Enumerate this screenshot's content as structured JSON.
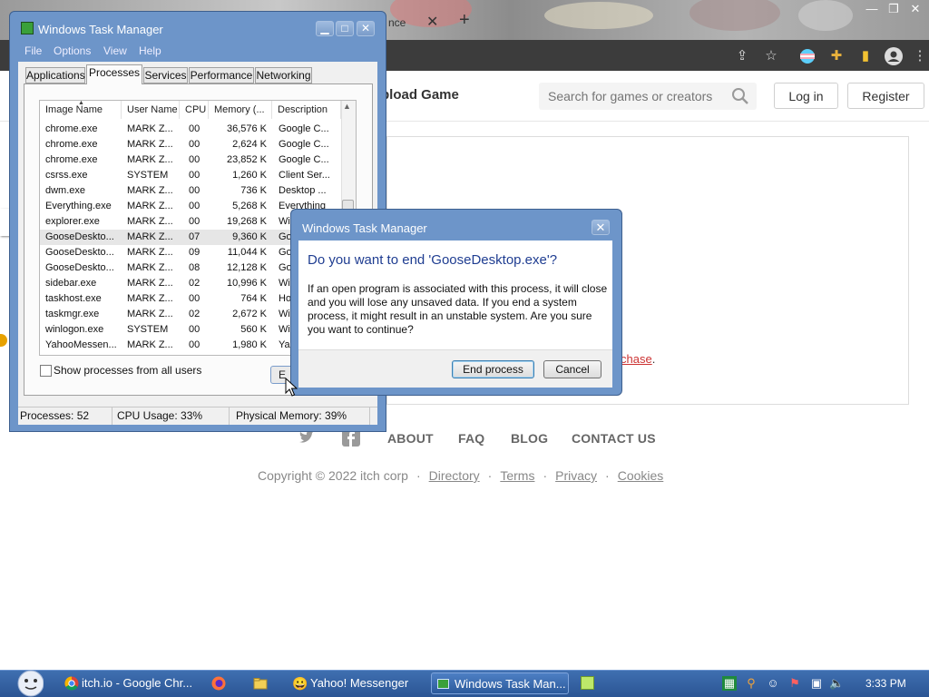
{
  "browser": {
    "tab_fragment": "nce",
    "new_tab_glyph": "+",
    "page": {
      "upload_label": "pload Game",
      "search_placeholder": "Search for games or creators",
      "login_label": "Log in",
      "register_label": "Register",
      "purchase_fragment": "chase",
      "purchase_suffix": ".",
      "footer": {
        "about": "ABOUT",
        "faq": "FAQ",
        "blog": "BLOG",
        "contact": "CONTACT US"
      },
      "copyright": "Copyright © 2022 itch corp",
      "links": {
        "directory": "Directory",
        "terms": "Terms",
        "privacy": "Privacy",
        "cookies": "Cookies"
      },
      "separator": "·"
    }
  },
  "task_manager": {
    "title": "Windows Task Manager",
    "menu": {
      "file": "File",
      "options": "Options",
      "view": "View",
      "help": "Help"
    },
    "tabs": {
      "applications": "Applications",
      "processes": "Processes",
      "services": "Services",
      "performance": "Performance",
      "networking": "Networking"
    },
    "columns": {
      "image_name": "Image Name",
      "user_name": "User Name",
      "cpu": "CPU",
      "memory": "Memory (...",
      "description": "Description"
    },
    "processes": [
      {
        "name": "chrome.exe",
        "user": "MARK Z...",
        "cpu": "00",
        "mem": "36,576 K",
        "desc": "Google C..."
      },
      {
        "name": "chrome.exe",
        "user": "MARK Z...",
        "cpu": "00",
        "mem": "2,624 K",
        "desc": "Google C..."
      },
      {
        "name": "chrome.exe",
        "user": "MARK Z...",
        "cpu": "00",
        "mem": "23,852 K",
        "desc": "Google C..."
      },
      {
        "name": "csrss.exe",
        "user": "SYSTEM",
        "cpu": "00",
        "mem": "1,260 K",
        "desc": "Client Ser..."
      },
      {
        "name": "dwm.exe",
        "user": "MARK Z...",
        "cpu": "00",
        "mem": "736 K",
        "desc": "Desktop ..."
      },
      {
        "name": "Everything.exe",
        "user": "MARK Z...",
        "cpu": "00",
        "mem": "5,268 K",
        "desc": "Everything"
      },
      {
        "name": "explorer.exe",
        "user": "MARK Z...",
        "cpu": "00",
        "mem": "19,268 K",
        "desc": "Wi"
      },
      {
        "name": "GooseDeskto...",
        "user": "MARK Z...",
        "cpu": "07",
        "mem": "9,360 K",
        "desc": "Go"
      },
      {
        "name": "GooseDeskto...",
        "user": "MARK Z...",
        "cpu": "09",
        "mem": "11,044 K",
        "desc": "Go"
      },
      {
        "name": "GooseDeskto...",
        "user": "MARK Z...",
        "cpu": "08",
        "mem": "12,128 K",
        "desc": "Go"
      },
      {
        "name": "sidebar.exe",
        "user": "MARK Z...",
        "cpu": "02",
        "mem": "10,996 K",
        "desc": "Wi"
      },
      {
        "name": "taskhost.exe",
        "user": "MARK Z...",
        "cpu": "00",
        "mem": "764 K",
        "desc": "Ho"
      },
      {
        "name": "taskmgr.exe",
        "user": "MARK Z...",
        "cpu": "02",
        "mem": "2,672 K",
        "desc": "Wi"
      },
      {
        "name": "winlogon.exe",
        "user": "SYSTEM",
        "cpu": "00",
        "mem": "560 K",
        "desc": "Wi"
      },
      {
        "name": "YahooMessen...",
        "user": "MARK Z...",
        "cpu": "00",
        "mem": "1,980 K",
        "desc": "Ya"
      }
    ],
    "show_all_label": "Show processes from all users",
    "end_button_fragment": "E",
    "status": {
      "processes": "Processes: 52",
      "cpu": "CPU Usage: 33%",
      "memory": "Physical Memory: 39%"
    }
  },
  "dialog": {
    "title": "Windows Task Manager",
    "question": "Do you want to end 'GooseDesktop.exe'?",
    "body": "If an open program is associated with this process, it will close and you will lose any unsaved data. If you end a system process, it might result in an unstable system. Are you sure you want to continue?",
    "end_process_label": "End process",
    "cancel_label": "Cancel"
  },
  "taskbar": {
    "chrome_label": "itch.io - Google Chr...",
    "yahoo_label": "Yahoo! Messenger",
    "taskmgr_label": "Windows Task Man...",
    "clock": "3:33 PM"
  },
  "colors": {
    "window_frame": "#6d95c9",
    "taskbar": "#2b5594",
    "dialog_question": "#1f3d91",
    "link_red": "#cc3333"
  }
}
